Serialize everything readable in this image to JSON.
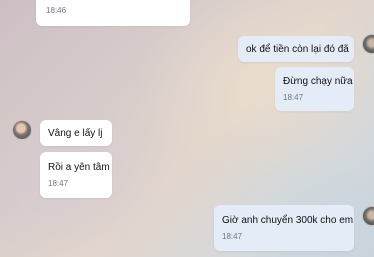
{
  "messages": [
    {
      "sender": "me",
      "text": "",
      "time": "18:46"
    },
    {
      "sender": "other",
      "text": "ok để tiền còn lại đó đã",
      "time": ""
    },
    {
      "sender": "other",
      "text": "Đừng chạy nữa",
      "time": "18:47"
    },
    {
      "sender": "me",
      "text": "Vâng e lấy lj",
      "time": ""
    },
    {
      "sender": "me",
      "text": "Rồi a yên tâm",
      "time": "18:47"
    },
    {
      "sender": "other",
      "text": "Giờ anh chuyển 300k cho em",
      "time": "18:47"
    }
  ],
  "icons": {
    "left_avatar": "avatar-icon",
    "right_avatar": "avatar-icon"
  }
}
